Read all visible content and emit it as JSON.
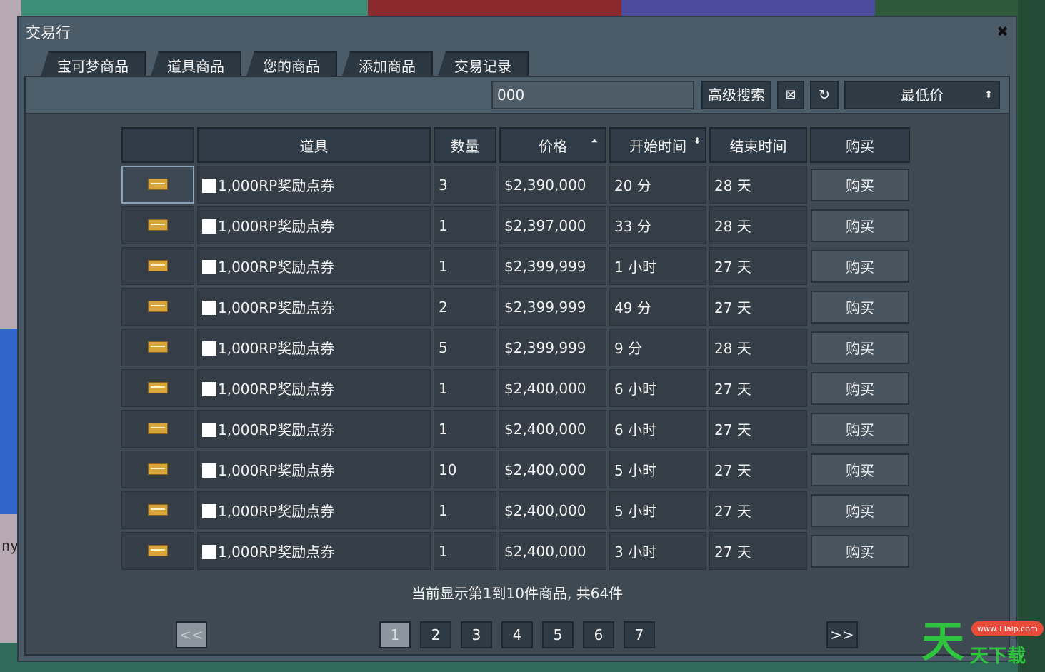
{
  "window": {
    "title": "交易行",
    "close": "✖"
  },
  "tabs": [
    "宝可梦商品",
    "道具商品",
    "您的商品",
    "添加商品",
    "交易记录"
  ],
  "toolbar": {
    "search_value": "000",
    "advanced_search": "高级搜索",
    "clear": "⊠",
    "refresh": "↻",
    "sort_value": "最低价",
    "sort_arrow": "⬍"
  },
  "table": {
    "headers": [
      "",
      "道具",
      "数量",
      "价格",
      "开始时间",
      "结束时间",
      "购买"
    ],
    "price_sort": "⏶",
    "start_sort": "⬍",
    "rows": [
      {
        "item": "1,000RP奖励点券",
        "qty": "3",
        "price": "$2,390,000",
        "start": "20 分",
        "end": "28 天",
        "buy": "购买"
      },
      {
        "item": "1,000RP奖励点券",
        "qty": "1",
        "price": "$2,397,000",
        "start": "33 分",
        "end": "28 天",
        "buy": "购买"
      },
      {
        "item": "1,000RP奖励点券",
        "qty": "1",
        "price": "$2,399,999",
        "start": "1 小时",
        "end": "27 天",
        "buy": "购买"
      },
      {
        "item": "1,000RP奖励点券",
        "qty": "2",
        "price": "$2,399,999",
        "start": "49 分",
        "end": "27 天",
        "buy": "购买"
      },
      {
        "item": "1,000RP奖励点券",
        "qty": "5",
        "price": "$2,399,999",
        "start": "9 分",
        "end": "28 天",
        "buy": "购买"
      },
      {
        "item": "1,000RP奖励点券",
        "qty": "1",
        "price": "$2,400,000",
        "start": "6 小时",
        "end": "27 天",
        "buy": "购买"
      },
      {
        "item": "1,000RP奖励点券",
        "qty": "1",
        "price": "$2,400,000",
        "start": "6 小时",
        "end": "27 天",
        "buy": "购买"
      },
      {
        "item": "1,000RP奖励点券",
        "qty": "10",
        "price": "$2,400,000",
        "start": "5 小时",
        "end": "27 天",
        "buy": "购买"
      },
      {
        "item": "1,000RP奖励点券",
        "qty": "1",
        "price": "$2,400,000",
        "start": "5 小时",
        "end": "27 天",
        "buy": "购买"
      },
      {
        "item": "1,000RP奖励点券",
        "qty": "1",
        "price": "$2,400,000",
        "start": "3 小时",
        "end": "27 天",
        "buy": "购买"
      }
    ]
  },
  "summary": "当前显示第1到10件商品, 共64件",
  "pagination": {
    "prev": "<<",
    "next": ">>",
    "pages": [
      "1",
      "2",
      "3",
      "4",
      "5",
      "6",
      "7"
    ],
    "current": "1"
  },
  "background_text": "ny",
  "watermark": {
    "big": "天",
    "small": "天下载",
    "badge": "www.TTalp.com"
  }
}
